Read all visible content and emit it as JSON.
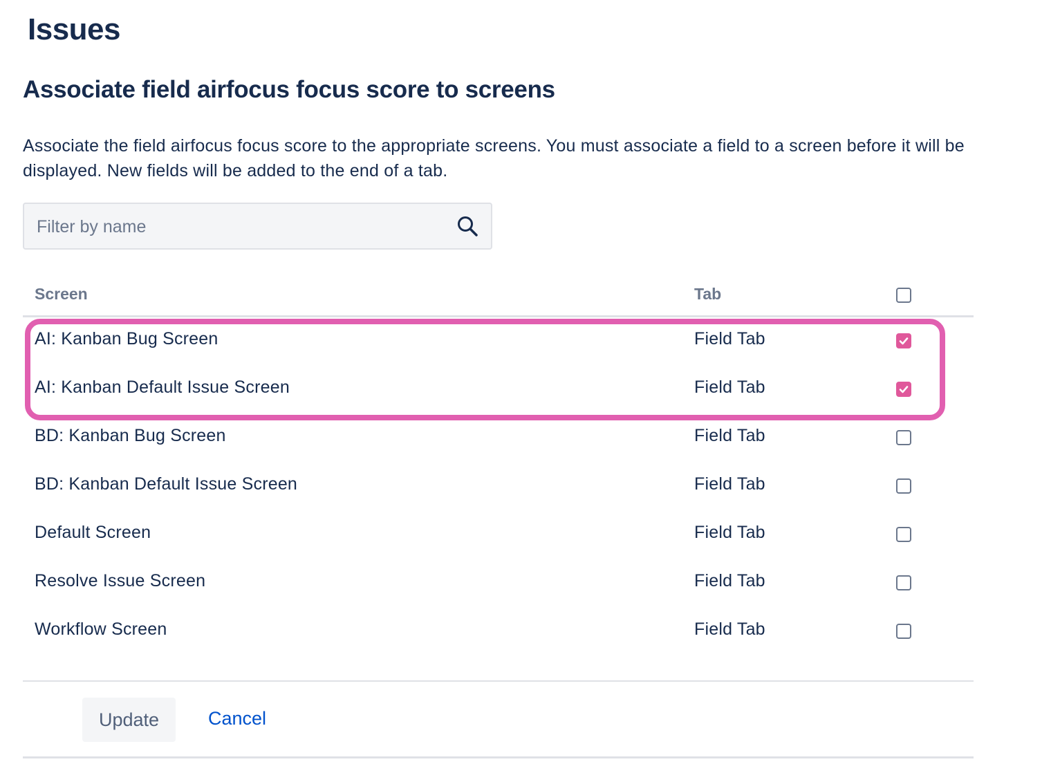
{
  "page": {
    "title": "Issues"
  },
  "section": {
    "title": "Associate field airfocus focus score to screens",
    "description": "Associate the field airfocus focus score to the appropriate screens. You must associate a field to a screen before it will be displayed. New fields will be added to the end of a tab."
  },
  "filter": {
    "placeholder": "Filter by name",
    "value": "",
    "icon": "search-icon"
  },
  "table": {
    "columns": {
      "screen": "Screen",
      "tab": "Tab"
    },
    "select_all_checked": false,
    "rows": [
      {
        "screen": "AI: Kanban Bug Screen",
        "tab": "Field Tab",
        "checked": true
      },
      {
        "screen": "AI: Kanban Default Issue Screen",
        "tab": "Field Tab",
        "checked": true
      },
      {
        "screen": "BD: Kanban Bug Screen",
        "tab": "Field Tab",
        "checked": false
      },
      {
        "screen": "BD: Kanban Default Issue Screen",
        "tab": "Field Tab",
        "checked": false
      },
      {
        "screen": "Default Screen",
        "tab": "Field Tab",
        "checked": false
      },
      {
        "screen": "Resolve Issue Screen",
        "tab": "Field Tab",
        "checked": false
      },
      {
        "screen": "Workflow Screen",
        "tab": "Field Tab",
        "checked": false
      }
    ]
  },
  "actions": {
    "update_label": "Update",
    "cancel_label": "Cancel"
  },
  "colors": {
    "highlight": "#e15fb0",
    "checkbox_checked": "#e0589b",
    "link": "#0052cc",
    "text": "#172b4d"
  }
}
